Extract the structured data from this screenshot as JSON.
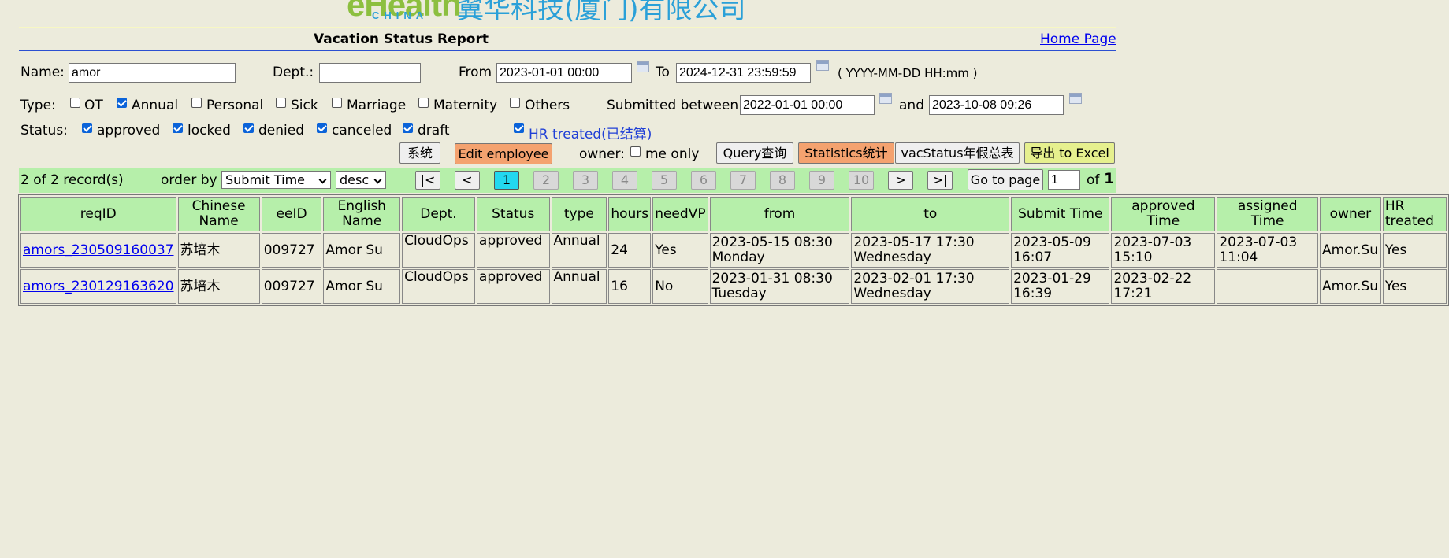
{
  "header": {
    "logo_e": "eHealth",
    "logo_china": "CHINA",
    "logo_company": "翼华科技(厦门)有限公司",
    "title": "Vacation Status Report",
    "home_link": "Home Page"
  },
  "filters": {
    "name_label": "Name:",
    "name_value": "amor",
    "dept_label": "Dept.:",
    "dept_value": "",
    "from_label": "From",
    "from_value": "2023-01-01 00:00",
    "to_label": "To",
    "to_value": "2024-12-31 23:59:59",
    "date_hint": "( YYYY-MM-DD HH:mm )",
    "type_label": "Type:",
    "types": [
      {
        "label": "OT",
        "checked": false
      },
      {
        "label": "Annual",
        "checked": true
      },
      {
        "label": "Personal",
        "checked": false
      },
      {
        "label": "Sick",
        "checked": false
      },
      {
        "label": "Marriage",
        "checked": false
      },
      {
        "label": "Maternity",
        "checked": false
      },
      {
        "label": "Others",
        "checked": false
      }
    ],
    "submitted_label": "Submitted between",
    "submitted_from": "2022-01-01 00:00",
    "and_label": "and",
    "submitted_to": "2023-10-08 09:26",
    "status_label": "Status:",
    "statuses": [
      {
        "label": "approved",
        "checked": true
      },
      {
        "label": "locked",
        "checked": true
      },
      {
        "label": "denied",
        "checked": true
      },
      {
        "label": "canceled",
        "checked": true
      },
      {
        "label": "draft",
        "checked": true
      }
    ],
    "hr_treated": {
      "label": "HR treated(已结算)",
      "checked": true
    },
    "owner_label": "owner:",
    "me_only": {
      "label": "me only",
      "checked": false
    }
  },
  "buttons": {
    "system": "系统",
    "edit_employee": "Edit employee",
    "query": "Query查询",
    "statistics": "Statistics统计",
    "vac_status": "vacStatus年假总表",
    "export": "导出 to Excel"
  },
  "colors": {
    "background": "#ecebdc",
    "green_bar": "#b6efaa",
    "orange_button": "#f4a26f",
    "yellow_button": "#e6f08e",
    "current_page": "#22d8f0",
    "link": "#0000ee"
  },
  "paging": {
    "record_count": "2 of 2 record(s)",
    "order_by_label": "order by",
    "order_field": "Submit Time",
    "order_dir": "desc",
    "first": "|<",
    "prev": "<",
    "pages": [
      "1",
      "2",
      "3",
      "4",
      "5",
      "6",
      "7",
      "8",
      "9",
      "10"
    ],
    "current_page": "1",
    "next": ">",
    "last": ">|",
    "go_to_page": "Go to page",
    "page_input": "1",
    "of_label": "of",
    "total_pages": "1"
  },
  "table": {
    "columns": [
      "reqID",
      "Chinese Name",
      "eeID",
      "English Name",
      "Dept.",
      "Status",
      "type",
      "hours",
      "needVP",
      "from",
      "to",
      "Submit Time",
      "approved Time",
      "assigned Time",
      "owner",
      "HR treated"
    ],
    "rows": [
      {
        "reqID": "amors_230509160037",
        "chinese_name": "苏培木",
        "eeID": "009727",
        "english_name": "Amor Su",
        "dept": "CloudOps",
        "status": "approved",
        "type": "Annual",
        "hours": "24",
        "needVP": "Yes",
        "from_date": "2023-05-15 08:30",
        "from_day": "Monday",
        "to_date": "2023-05-17 17:30",
        "to_day": "Wednesday",
        "submit_date": "2023-05-09",
        "submit_time": "16:07",
        "approved_date": "2023-07-03",
        "approved_time": "15:10",
        "assigned_date": "2023-07-03",
        "assigned_time": "11:04",
        "owner": "Amor.Su",
        "hr_treated": "Yes"
      },
      {
        "reqID": "amors_230129163620",
        "chinese_name": "苏培木",
        "eeID": "009727",
        "english_name": "Amor Su",
        "dept": "CloudOps",
        "status": "approved",
        "type": "Annual",
        "hours": "16",
        "needVP": "No",
        "from_date": "2023-01-31 08:30",
        "from_day": "Tuesday",
        "to_date": "2023-02-01 17:30",
        "to_day": "Wednesday",
        "submit_date": "2023-01-29",
        "submit_time": "16:39",
        "approved_date": "2023-02-22",
        "approved_time": "17:21",
        "assigned_date": "",
        "assigned_time": "",
        "owner": "Amor.Su",
        "hr_treated": "Yes"
      }
    ]
  }
}
